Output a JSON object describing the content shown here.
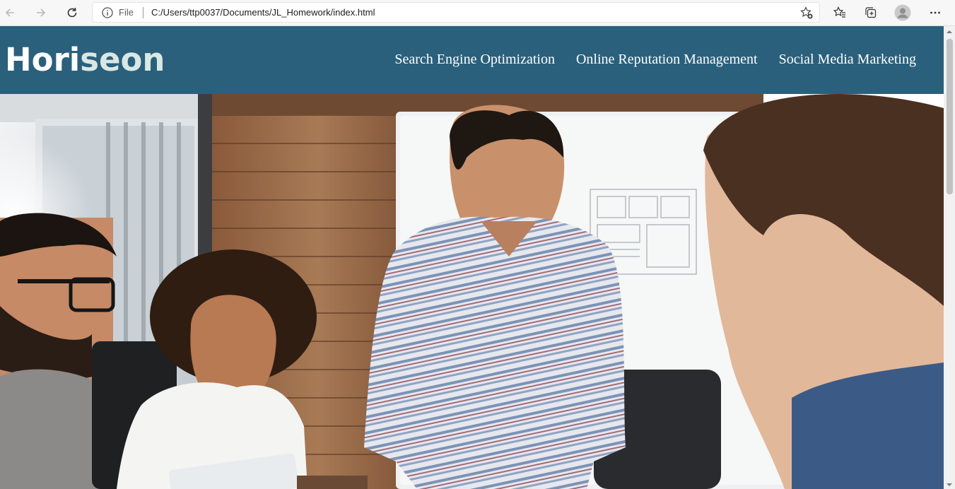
{
  "browser": {
    "address_scheme": "File",
    "address_url": "C:/Users/ttp0037/Documents/JL_Homework/index.html",
    "icons": [
      "back-icon",
      "forward-icon",
      "refresh-icon",
      "info-icon",
      "add-favorite-icon",
      "favorites-icon",
      "collections-icon",
      "profile-icon",
      "more-icon"
    ]
  },
  "site": {
    "logo_part1": "Hori",
    "logo_part2": "seon",
    "nav": [
      {
        "label": "Search Engine Optimization"
      },
      {
        "label": "Online Reputation Management"
      },
      {
        "label": "Social Media Marketing"
      }
    ],
    "colors": {
      "header_bg": "#2a607c",
      "logo_text": "#ffffff",
      "logo_accent": "#d9e8e4"
    }
  }
}
